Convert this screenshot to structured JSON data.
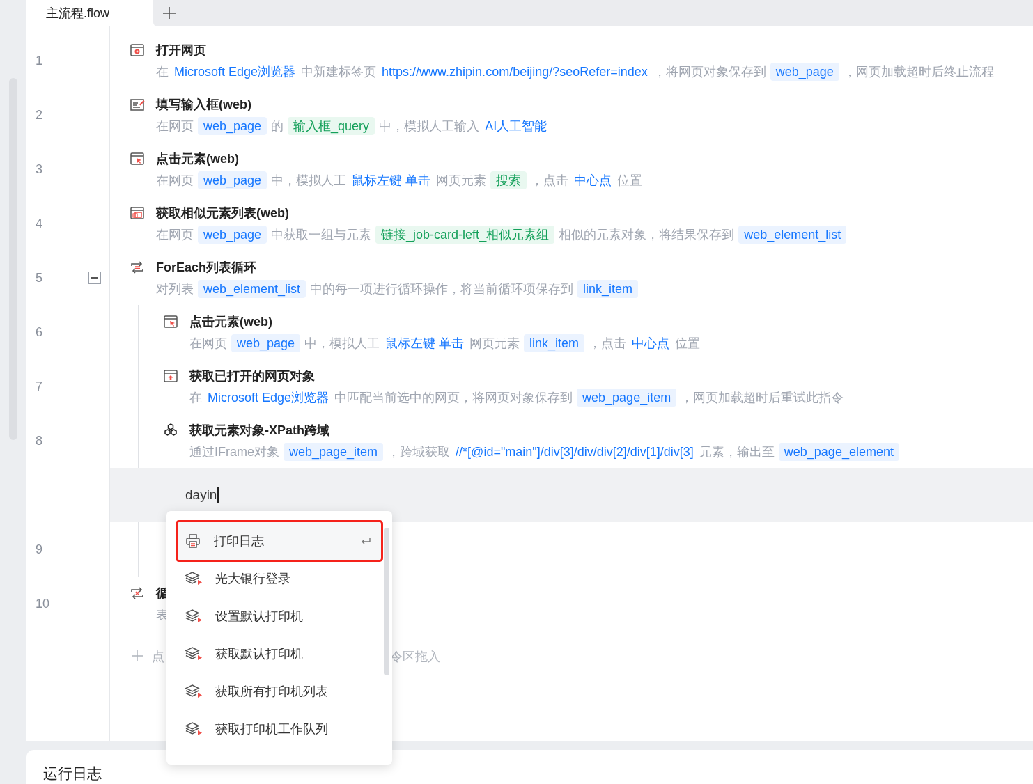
{
  "tabs": [
    {
      "label": "主流程.flow",
      "selected": true
    }
  ],
  "lines": [
    {
      "number": "1",
      "kind": "open-page",
      "title": "打开网页",
      "desc": [
        {
          "kind": "text",
          "text": "在"
        },
        {
          "kind": "link",
          "text": "Microsoft Edge浏览器"
        },
        {
          "kind": "text",
          "text": "中新建标签页"
        },
        {
          "kind": "link",
          "text": "https://www.zhipin.com/beijing/?seoRefer=index"
        },
        {
          "kind": "text",
          "text": "，将网页对象保存到"
        },
        {
          "kind": "var",
          "text": "web_page"
        },
        {
          "kind": "text",
          "text": "，网页加载超时后终止流程"
        }
      ]
    },
    {
      "number": "2",
      "kind": "fill-input",
      "title": "填写输入框(web)",
      "desc": [
        {
          "kind": "text",
          "text": "在网页"
        },
        {
          "kind": "var",
          "text": "web_page"
        },
        {
          "kind": "text",
          "text": "的"
        },
        {
          "kind": "elem",
          "text": "输入框_query"
        },
        {
          "kind": "text",
          "text": "中，模拟人工输入"
        },
        {
          "kind": "link",
          "text": "AI人工智能"
        }
      ]
    },
    {
      "number": "3",
      "kind": "click",
      "title": "点击元素(web)",
      "desc": [
        {
          "kind": "text",
          "text": "在网页"
        },
        {
          "kind": "var",
          "text": "web_page"
        },
        {
          "kind": "text",
          "text": "中，模拟人工"
        },
        {
          "kind": "link",
          "text": "鼠标左键 单击"
        },
        {
          "kind": "text",
          "text": "网页元素"
        },
        {
          "kind": "elem",
          "text": "搜索"
        },
        {
          "kind": "text",
          "text": "，点击"
        },
        {
          "kind": "link",
          "text": "中心点"
        },
        {
          "kind": "text",
          "text": "位置"
        }
      ]
    },
    {
      "number": "4",
      "kind": "similar-list",
      "title": "获取相似元素列表(web)",
      "desc": [
        {
          "kind": "text",
          "text": "在网页"
        },
        {
          "kind": "var",
          "text": "web_page"
        },
        {
          "kind": "text",
          "text": "中获取一组与元素"
        },
        {
          "kind": "elem",
          "text": "链接_job-card-left_相似元素组"
        },
        {
          "kind": "text",
          "text": "相似的元素对象，将结果保存到"
        },
        {
          "kind": "var",
          "text": "web_element_list"
        }
      ]
    },
    {
      "number": "5",
      "kind": "foreach",
      "title": "ForEach列表循环",
      "expanded": true,
      "desc": [
        {
          "kind": "text",
          "text": "对列表"
        },
        {
          "kind": "var",
          "text": "web_element_list"
        },
        {
          "kind": "text",
          "text": "中的每一项进行循环操作，将当前循环项保存到"
        },
        {
          "kind": "var",
          "text": "link_item"
        }
      ],
      "children": [
        {
          "number": "6",
          "kind": "click",
          "title": "点击元素(web)",
          "desc": [
            {
              "kind": "text",
              "text": "在网页"
            },
            {
              "kind": "var",
              "text": "web_page"
            },
            {
              "kind": "text",
              "text": "中，模拟人工"
            },
            {
              "kind": "link",
              "text": "鼠标左键 单击"
            },
            {
              "kind": "text",
              "text": "网页元素"
            },
            {
              "kind": "var",
              "text": "link_item"
            },
            {
              "kind": "text",
              "text": "，点击"
            },
            {
              "kind": "link",
              "text": "中心点"
            },
            {
              "kind": "text",
              "text": "位置"
            }
          ]
        },
        {
          "number": "7",
          "kind": "get-page",
          "title": "获取已打开的网页对象",
          "desc": [
            {
              "kind": "text",
              "text": "在"
            },
            {
              "kind": "link",
              "text": "Microsoft Edge浏览器"
            },
            {
              "kind": "text",
              "text": "中匹配当前选中的网页，将网页对象保存到"
            },
            {
              "kind": "var",
              "text": "web_page_item"
            },
            {
              "kind": "text",
              "text": "，网页加载超时后重试此指令"
            }
          ]
        },
        {
          "number": "8",
          "kind": "xpath",
          "title": "获取元素对象-XPath跨域",
          "desc": [
            {
              "kind": "text",
              "text": "通过IFrame对象"
            },
            {
              "kind": "var",
              "text": "web_page_item"
            },
            {
              "kind": "text",
              "text": "，跨域获取"
            },
            {
              "kind": "link",
              "text": "//*[@id=\"main\"]/div[3]/div/div[2]/div[1]/div[3]"
            },
            {
              "kind": "text",
              "text": "元素，输出至"
            },
            {
              "kind": "var",
              "text": "web_page_element"
            }
          ]
        },
        {
          "kind": "input",
          "value": "dayin"
        },
        {
          "number": "9",
          "kind": "hidden"
        }
      ]
    },
    {
      "number": "10",
      "kind": "loop-break",
      "title": "循",
      "desc": [
        {
          "kind": "text",
          "text": "表"
        }
      ]
    }
  ],
  "add_hint": {
    "left": "点",
    "right": "令区拖入"
  },
  "suggestions": [
    {
      "label": "打印日志",
      "kind": "print",
      "selected": true
    },
    {
      "label": "光大银行登录",
      "kind": "module",
      "selected": false
    },
    {
      "label": "设置默认打印机",
      "kind": "module",
      "selected": false
    },
    {
      "label": "获取默认打印机",
      "kind": "module",
      "selected": false
    },
    {
      "label": "获取所有打印机列表",
      "kind": "module",
      "selected": false
    },
    {
      "label": "获取打印机工作队列",
      "kind": "module",
      "selected": false
    }
  ],
  "log_panel": {
    "title": "运行日志"
  }
}
